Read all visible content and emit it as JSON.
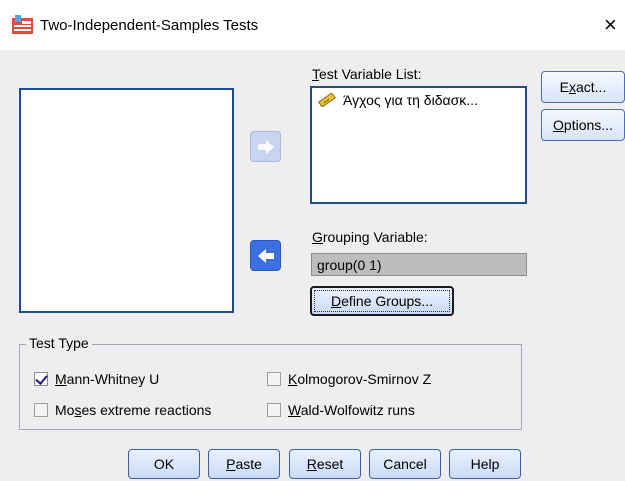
{
  "window": {
    "title": "Two-Independent-Samples Tests",
    "close_glyph": "×"
  },
  "source_list": {
    "items": []
  },
  "test_variable_list": {
    "label_hotkey": "T",
    "label_rest": "est Variable List:",
    "items": [
      {
        "icon": "ruler-icon",
        "label": "Άγχος για τη διδασκ..."
      }
    ]
  },
  "grouping_variable": {
    "label_hotkey": "G",
    "label_rest": "rouping Variable:",
    "value": "group(0 1)",
    "define_groups_hotkey": "D",
    "define_groups_rest": "efine Groups..."
  },
  "side_buttons": {
    "exact_pre": "E",
    "exact_hotkey": "x",
    "exact_post": "act...",
    "options_hotkey": "O",
    "options_rest": "ptions..."
  },
  "test_type": {
    "legend": "Test Type",
    "mann_whitney": {
      "label_hotkey": "M",
      "label_rest": "ann-Whitney U",
      "checked": true
    },
    "kolmogorov": {
      "label_hotkey": "K",
      "label_rest": "olmogorov-Smirnov Z",
      "checked": false
    },
    "moses": {
      "label_pre": "Mo",
      "label_hotkey": "s",
      "label_post": "es extreme reactions",
      "checked": false
    },
    "wald": {
      "label_hotkey": "W",
      "label_rest": "ald-Wolfowitz runs",
      "checked": false
    }
  },
  "buttons": {
    "ok": "OK",
    "paste_hotkey": "P",
    "paste_rest": "aste",
    "reset_hotkey": "R",
    "reset_rest": "eset",
    "cancel": "Cancel",
    "help": "Help"
  },
  "colors": {
    "accent": "#3d6fe0",
    "listbox_border": "#1f4e8c",
    "dialog_bg": "#eeeef0"
  }
}
